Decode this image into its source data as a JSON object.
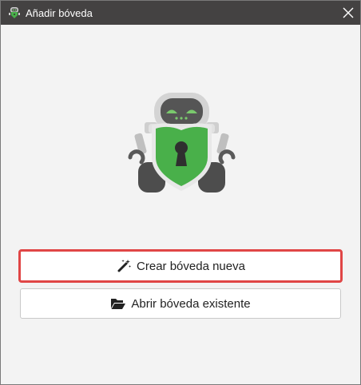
{
  "window": {
    "title": "Añadir bóveda",
    "app_icon": "cryptomator-robot-icon",
    "close_icon": "close-icon"
  },
  "illustration": {
    "name": "cryptomator-mascot",
    "colors": {
      "shield": "#49b04a",
      "robot_head": "#d7d7d7",
      "visor": "#5a5a5a",
      "wheels": "#4a4a4a",
      "eyes": "#76c76c"
    }
  },
  "buttons": {
    "create_label": "Crear bóveda nueva",
    "create_icon": "magic-wand-icon",
    "open_label": "Abrir bóveda existente",
    "open_icon": "folder-open-icon"
  },
  "colors": {
    "titlebar": "#444242",
    "highlight_border": "#e04646"
  }
}
